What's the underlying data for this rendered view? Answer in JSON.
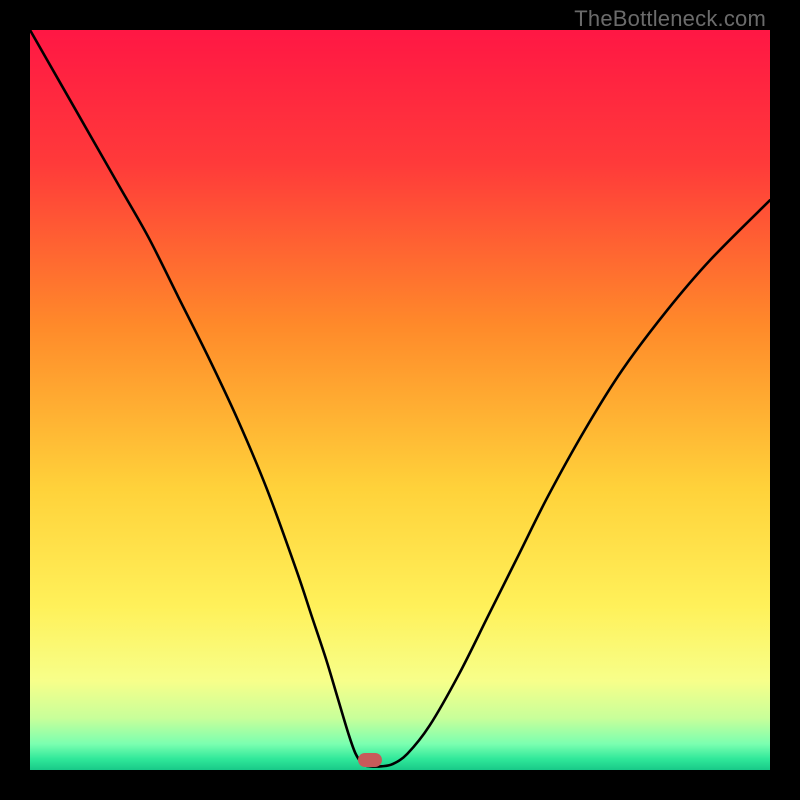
{
  "watermark": "TheBottleneck.com",
  "chart_data": {
    "type": "line",
    "title": "",
    "xlabel": "",
    "ylabel": "",
    "xlim": [
      0,
      100
    ],
    "ylim": [
      0,
      100
    ],
    "grid": false,
    "background_gradient": {
      "stops": [
        {
          "pos": 0.0,
          "color": "#ff1744"
        },
        {
          "pos": 0.18,
          "color": "#ff3a3a"
        },
        {
          "pos": 0.4,
          "color": "#ff8a2a"
        },
        {
          "pos": 0.62,
          "color": "#ffd23a"
        },
        {
          "pos": 0.78,
          "color": "#fff15a"
        },
        {
          "pos": 0.88,
          "color": "#f7ff8a"
        },
        {
          "pos": 0.93,
          "color": "#c8ff9a"
        },
        {
          "pos": 0.965,
          "color": "#7affb0"
        },
        {
          "pos": 0.985,
          "color": "#30e89a"
        },
        {
          "pos": 1.0,
          "color": "#18c988"
        }
      ]
    },
    "series": [
      {
        "name": "bottleneck-curve",
        "color": "#000000",
        "x": [
          0.0,
          4,
          8,
          12,
          16,
          20,
          24,
          28,
          32,
          36,
          38,
          40,
          41.5,
          43,
          44,
          45,
          46,
          47.5,
          49,
          51,
          54,
          58,
          62,
          66,
          70,
          75,
          80,
          86,
          92,
          100
        ],
        "y": [
          100,
          93,
          86,
          79,
          72,
          64,
          56,
          47.5,
          38,
          27,
          21,
          15,
          10,
          5,
          2.2,
          0.8,
          0.5,
          0.5,
          0.8,
          2.2,
          6,
          13,
          21,
          29,
          37,
          46,
          54,
          62,
          69,
          77
        ]
      }
    ],
    "marker": {
      "x": 46,
      "y": 1.3,
      "color": "#c85a5a",
      "name": "current-point"
    }
  }
}
